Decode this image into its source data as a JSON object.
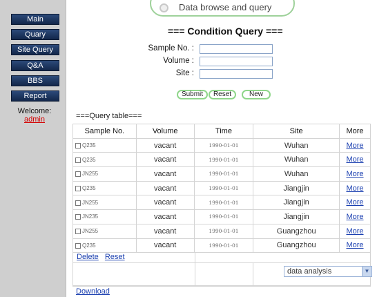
{
  "sidebar": {
    "items": [
      {
        "label": "Main"
      },
      {
        "label": "Quary"
      },
      {
        "label": "Site Query"
      },
      {
        "label": "Q&A"
      },
      {
        "label": "BBS"
      },
      {
        "label": "Report"
      }
    ],
    "welcome_label": "Welcome:",
    "user": "admin"
  },
  "banner": {
    "title": "Data browse and query"
  },
  "condition": {
    "title": "=== Condition Query ===",
    "fields": [
      {
        "label": "Sample No. :",
        "value": ""
      },
      {
        "label": "Volume :",
        "value": ""
      },
      {
        "label": "Site :",
        "value": ""
      }
    ],
    "buttons": {
      "submit": "Submit",
      "reset": "Reset",
      "new": "New"
    }
  },
  "table": {
    "title": "===Query table===",
    "headers": [
      "Sample No.",
      "Volume",
      "Time",
      "Site",
      "More"
    ],
    "rows": [
      {
        "sample": "Q235",
        "volume": "vacant",
        "time": "1990-01-01",
        "site": "Wuhan",
        "more": "More"
      },
      {
        "sample": "Q235",
        "volume": "vacant",
        "time": "1990-01-01",
        "site": "Wuhan",
        "more": "More"
      },
      {
        "sample": "JN255",
        "volume": "vacant",
        "time": "1990-01-01",
        "site": "Wuhan",
        "more": "More"
      },
      {
        "sample": "Q235",
        "volume": "vacant",
        "time": "1990-01-01",
        "site": "Jiangjin",
        "more": "More"
      },
      {
        "sample": "JN255",
        "volume": "vacant",
        "time": "1990-01-01",
        "site": "Jiangjin",
        "more": "More"
      },
      {
        "sample": "JN235",
        "volume": "vacant",
        "time": "1990-01-01",
        "site": "Jiangjin",
        "more": "More"
      },
      {
        "sample": "JN255",
        "volume": "vacant",
        "time": "1990-01-01",
        "site": "Guangzhou",
        "more": "More"
      },
      {
        "sample": "Q235",
        "volume": "vacant",
        "time": "1990-01-01",
        "site": "Guangzhou",
        "more": "More"
      }
    ],
    "delete_label": "Delete",
    "reset_label": "Reset"
  },
  "analysis": {
    "selected": "data analysis"
  },
  "download_label": "Download",
  "colors": {
    "sidebar_bg": "#cfcfcf",
    "nav_button": "#1a3360",
    "accent_green": "#8fd68a",
    "link_blue": "#1a3fb0",
    "user_red": "#d40000"
  }
}
